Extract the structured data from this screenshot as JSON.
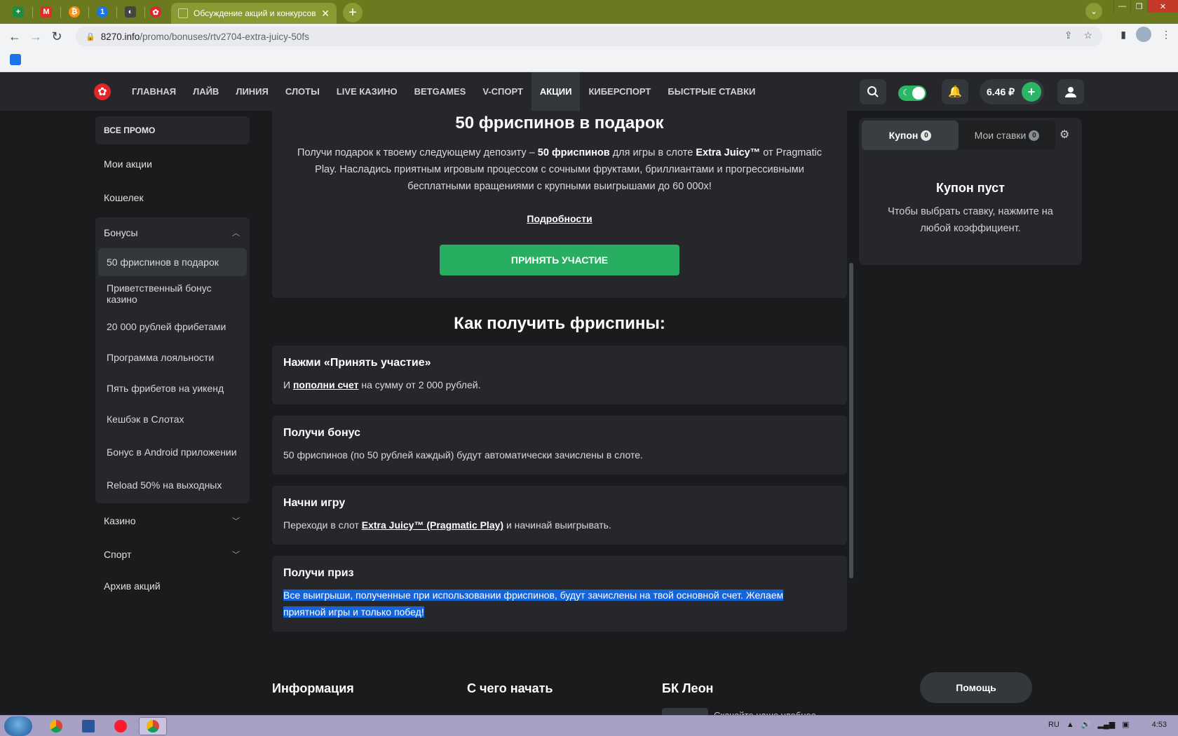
{
  "browser": {
    "tabs": [
      {
        "icon": "sheets-icon",
        "color": "#1e8e3e",
        "glyph": "+"
      },
      {
        "icon": "gmail-icon",
        "color": "#d93025",
        "glyph": "M"
      },
      {
        "icon": "bitcoin-icon",
        "color": "#f7931a",
        "glyph": "₿"
      },
      {
        "icon": "password-icon",
        "color": "#1a73e8",
        "glyph": "1"
      },
      {
        "icon": "app-icon",
        "color": "#444444",
        "glyph": "◐"
      },
      {
        "icon": "leon-icon",
        "color": "#e0262b",
        "glyph": "✿"
      }
    ],
    "active_tab_title": "Обсуждение акций и конкурсов",
    "url_host": "8270.info",
    "url_path": "/promo/bonuses/rtv2704-extra-juicy-50fs"
  },
  "header": {
    "nav": [
      "ГЛАВНАЯ",
      "ЛАЙВ",
      "ЛИНИЯ",
      "СЛОТЫ",
      "LIVE КАЗИНО",
      "BETGAMES",
      "V-СПОРТ",
      "АКЦИИ",
      "КИБЕРСПОРТ",
      "БЫСТРЫЕ СТАВКИ"
    ],
    "active_nav": "АКЦИИ",
    "balance": "6.46 ₽"
  },
  "sidebar": {
    "all_promo": "ВСЕ ПРОМО",
    "my_promos": "Мои акции",
    "wallet": "Кошелек",
    "bonuses": {
      "label": "Бонусы",
      "items": [
        "50 фриспинов в подарок",
        "Приветственный бонус казино",
        "20 000 рублей фрибетами",
        "Программа лояльности",
        "Пять фрибетов на уикенд",
        "Кешбэк в Слотах",
        "Бонус в Android приложении",
        "Reload 50% на выходных"
      ]
    },
    "casino": "Казино",
    "sport": "Спорт",
    "archive": "Архив акций"
  },
  "promo": {
    "title": "50 фриспинов в подарок",
    "desc_1": "Получи подарок к твоему следующему депозиту – ",
    "desc_bold_1": "50 фриспинов",
    "desc_2": " для игры в слоте ",
    "desc_bold_2": "Extra Juicy™",
    "desc_3": " от Pragmatic Play. Насладись приятным игровым процессом с сочными фруктами, бриллиантами и прогрессивными бесплатными вращениями с крупными выигрышами до 60 000x!",
    "details": "Подробности",
    "cta": "ПРИНЯТЬ УЧАСТИЕ"
  },
  "how": {
    "title": "Как получить фриспины:",
    "step1_title": "Нажми «Принять участие»",
    "step1_pre": "И ",
    "step1_link": "пополни счет",
    "step1_post": " на сумму от 2 000 рублей.",
    "step2_title": "Получи бонус",
    "step2_text": "50 фриспинов (по 50 рублей каждый) будут автоматически зачислены в слоте.",
    "step3_title": "Начни игру",
    "step3_pre": "Переходи в слот ",
    "step3_link": "Extra Juicy™ (Pragmatic Play)",
    "step3_post": " и начинай выигрывать.",
    "step4_title": "Получи приз",
    "step4_line1": "Все выигрыши, полученные при использовании фриспинов, будут зачислены на твой основной счет. Желаем",
    "step4_line2": "приятной игры и только побед!"
  },
  "coupon": {
    "tab_coupon": "Купон",
    "tab_coupon_count": "0",
    "tab_bets": "Мои ставки",
    "tab_bets_count": "0",
    "empty_title": "Купон пуст",
    "empty_text": "Чтобы выбрать ставку, нажмите на любой коэффициент."
  },
  "footer": {
    "col1": "Информация",
    "col2": "С чего начать",
    "col3": "БК Леон",
    "app_text": "Скачайте наше удобное",
    "help": "Помощь"
  },
  "taskbar": {
    "lang": "RU",
    "time": "4:53"
  }
}
